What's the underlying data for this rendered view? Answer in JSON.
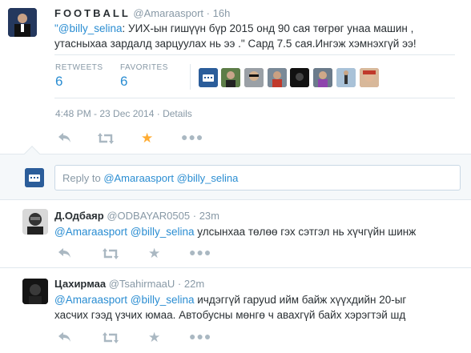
{
  "main_tweet": {
    "name": "FOOTBALL",
    "handle": "@Amaraasport",
    "sep": "·",
    "time": "16h",
    "text_open_quote": "\"",
    "mention": "@billy_selina",
    "text_line1": ": УИХ-ын гишүүн бүр  2015 онд 90 сая төгрөг унаа машин ,",
    "text_line2": "утасныхаа зардалд зарцуулах нь ээ .\" Сард 7.5 сая.Ингэж хэмнэхгүй ээ!",
    "retweets_label": "RETWEETS",
    "retweets_count": "6",
    "favorites_label": "FAVORITES",
    "favorites_count": "6",
    "timestamp": "4:48 PM - 23 Dec 2014",
    "details_sep": "·",
    "details": "Details"
  },
  "reply_box": {
    "placeholder_prefix": "Reply to ",
    "mention1": "@Amaraasport",
    "mention2": "@billy_selina"
  },
  "replies": [
    {
      "name": "Д.Одбаяр",
      "handle": "@ODBAYAR0505",
      "sep": "·",
      "time": "23m",
      "mention1": "@Amaraasport",
      "mention2": "@billy_selina",
      "text": " улсынхаа төлөө гэх сэтгэл нь хүчгүйн шинж"
    },
    {
      "name": "Цахирмаа",
      "handle": "@TsahirmaaU",
      "sep": "·",
      "time": "22m",
      "mention1": "@Amaraasport",
      "mention2": "@billy_selina",
      "text_line1": " ичдэггүй гаруud ийм байж хүүхдийн 20-ыг",
      "text_line2": "хасчих гээд үзчих юмаа. Автобусны мөнгө ч авахгүй байх хэрэгтэй шд"
    }
  ],
  "colors": {
    "link": "#2a8dd2",
    "favorited": "#ffac33",
    "muted": "#8899a6",
    "bg_reply": "#f5f8fa"
  }
}
